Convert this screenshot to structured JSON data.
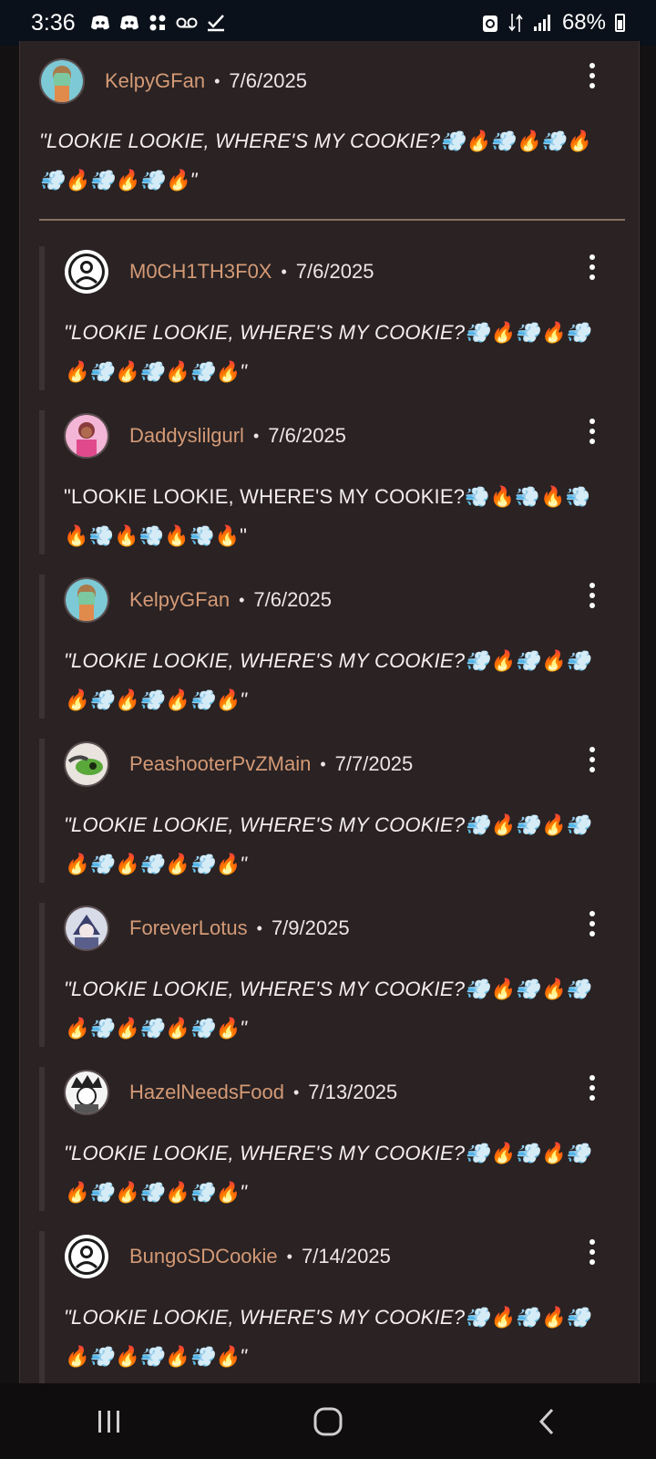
{
  "status_bar": {
    "time": "3:36",
    "battery": "68%",
    "left_icons": [
      "discord-icon",
      "discord-icon",
      "app-icon",
      "voicemail-icon",
      "check-icon"
    ],
    "right_icons": [
      "recycle-icon",
      "data-arrows-icon",
      "signal-icon"
    ]
  },
  "comments": [
    {
      "username": "KelpyGFan",
      "date": "7/6/2025",
      "text": "\"LOOKIE LOOKIE, WHERE'S MY COOKIE?💨🔥💨🔥💨🔥💨🔥💨🔥💨🔥\"",
      "italic": true,
      "avatar": "kelpy"
    },
    {
      "username": "M0CH1TH3F0X",
      "date": "7/6/2025",
      "text": "\"LOOKIE LOOKIE, WHERE'S MY COOKIE?💨🔥💨🔥💨🔥💨🔥💨🔥💨🔥\"",
      "italic": true,
      "avatar": "default"
    },
    {
      "username": "Daddyslilgurl",
      "date": "7/6/2025",
      "text": "\"LOOKIE LOOKIE, WHERE'S MY COOKIE?💨🔥💨🔥💨🔥💨🔥💨🔥💨🔥\"",
      "italic": false,
      "avatar": "pink"
    },
    {
      "username": "KelpyGFan",
      "date": "7/6/2025",
      "text": "\"LOOKIE LOOKIE, WHERE'S MY COOKIE?💨🔥💨🔥💨🔥💨🔥💨🔥💨🔥\"",
      "italic": true,
      "avatar": "kelpy"
    },
    {
      "username": "PeashooterPvZMain",
      "date": "7/7/2025",
      "text": "\"LOOKIE LOOKIE, WHERE'S MY COOKIE?💨🔥💨🔥💨🔥💨🔥💨🔥💨🔥\"",
      "italic": true,
      "avatar": "peashooter"
    },
    {
      "username": "ForeverLotus",
      "date": "7/9/2025",
      "text": "\"LOOKIE LOOKIE, WHERE'S MY COOKIE?💨🔥💨🔥💨🔥💨🔥💨🔥💨🔥\"",
      "italic": true,
      "avatar": "lotus"
    },
    {
      "username": "HazelNeedsFood",
      "date": "7/13/2025",
      "text": "\"LOOKIE LOOKIE, WHERE'S MY COOKIE?💨🔥💨🔥💨🔥💨🔥💨🔥💨🔥\"",
      "italic": true,
      "avatar": "hazel"
    },
    {
      "username": "BungoSDCookie",
      "date": "7/14/2025",
      "text": "\"LOOKIE LOOKIE, WHERE'S MY COOKIE?💨🔥💨🔥💨🔥💨🔥💨🔥💨🔥\"",
      "italic": true,
      "avatar": "default"
    }
  ],
  "separator": "•",
  "nav": {
    "recents": "recents-icon",
    "home": "home-icon",
    "back": "back-icon"
  },
  "colors": {
    "username": "#d49a76",
    "card_bg": "#2a2223",
    "divider": "#8a6f60"
  }
}
